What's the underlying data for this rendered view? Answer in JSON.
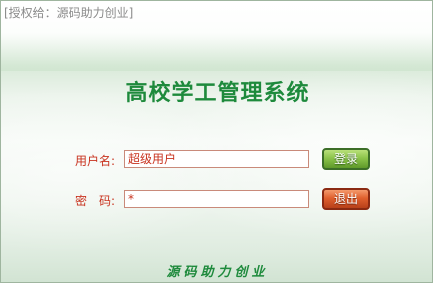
{
  "license": "[授权给：源码助力创业]",
  "title": "高校学工管理系统",
  "form": {
    "username_label": "用户名:",
    "username_value": "超级用户",
    "password_label": "密　码:",
    "password_value": "*"
  },
  "buttons": {
    "login": "登录",
    "exit": "退出"
  },
  "footer": "源码助力创业",
  "colors": {
    "title": "#1e8a3c",
    "label": "#c8321e",
    "login_button": "#8cc44a",
    "exit_button": "#e0602e"
  }
}
